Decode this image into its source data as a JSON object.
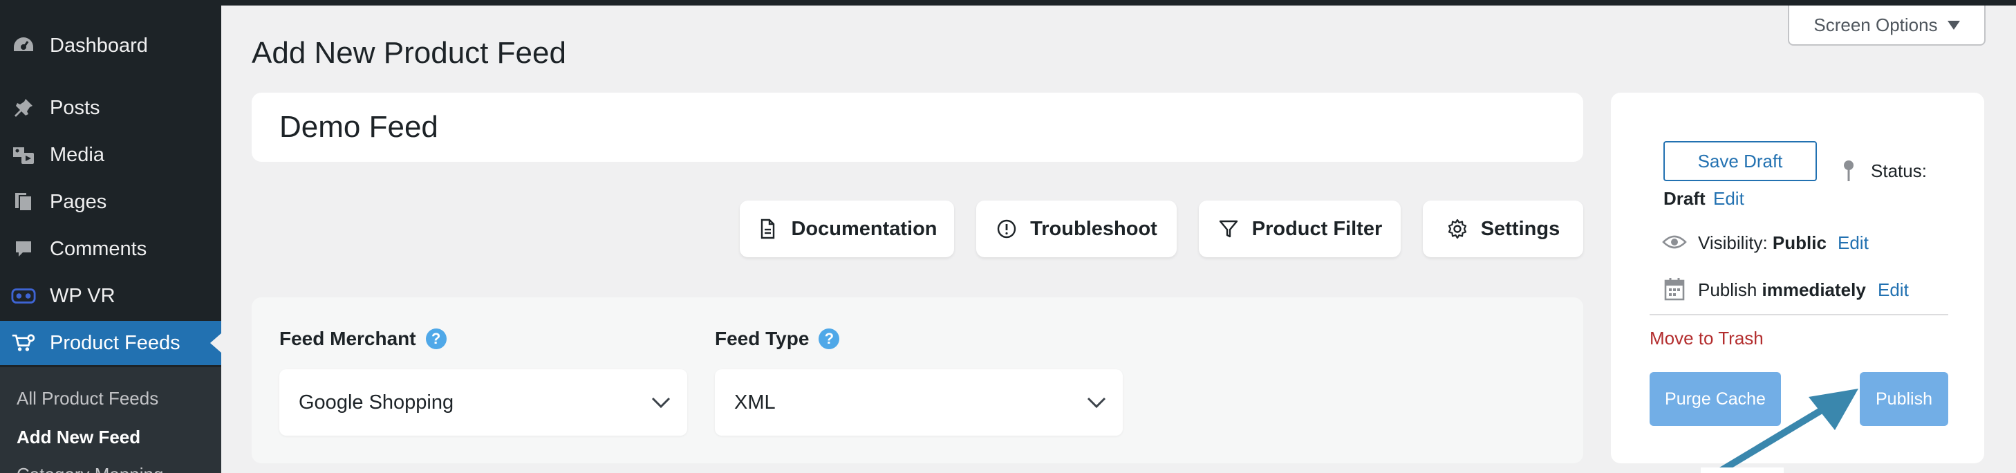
{
  "sidebar": {
    "items": [
      {
        "label": "Dashboard",
        "icon": "dashboard-icon"
      },
      {
        "label": "Posts",
        "icon": "pushpin-icon"
      },
      {
        "label": "Media",
        "icon": "media-icon"
      },
      {
        "label": "Pages",
        "icon": "pages-icon"
      },
      {
        "label": "Comments",
        "icon": "comments-icon"
      },
      {
        "label": "WP VR",
        "icon": "vr-headset-icon"
      },
      {
        "label": "Product Feeds",
        "icon": "cart-icon"
      }
    ],
    "submenu": [
      "All Product Feeds",
      "Add New Feed",
      "Category Mapping"
    ]
  },
  "header": {
    "title": "Add New Product Feed",
    "screen_options": "Screen Options"
  },
  "title_box": {
    "value": "Demo Feed"
  },
  "toolbar": {
    "documentation": "Documentation",
    "troubleshoot": "Troubleshoot",
    "product_filter": "Product Filter",
    "settings": "Settings"
  },
  "feed": {
    "merchant_label": "Feed Merchant",
    "merchant_value": "Google Shopping",
    "type_label": "Feed Type",
    "type_value": "XML",
    "help": "?"
  },
  "publish": {
    "save_draft": "Save Draft",
    "status_label": "Status:",
    "status_value": "Draft",
    "edit": "Edit",
    "visibility_label": "Visibility:",
    "visibility_value": "Public",
    "publish_label": "Publish",
    "publish_value": "immediately",
    "move_to_trash": "Move to Trash",
    "purge_cache": "Purge Cache",
    "publish_button": "Publish"
  },
  "colors": {
    "sidebar_bg": "#1d2327",
    "active_item": "#2271b1",
    "link": "#2271b1",
    "trash": "#b32d2e",
    "primary_disabled": "#72aee6",
    "help_badge": "#4fa8e8",
    "arrow": "#3a87ad"
  }
}
